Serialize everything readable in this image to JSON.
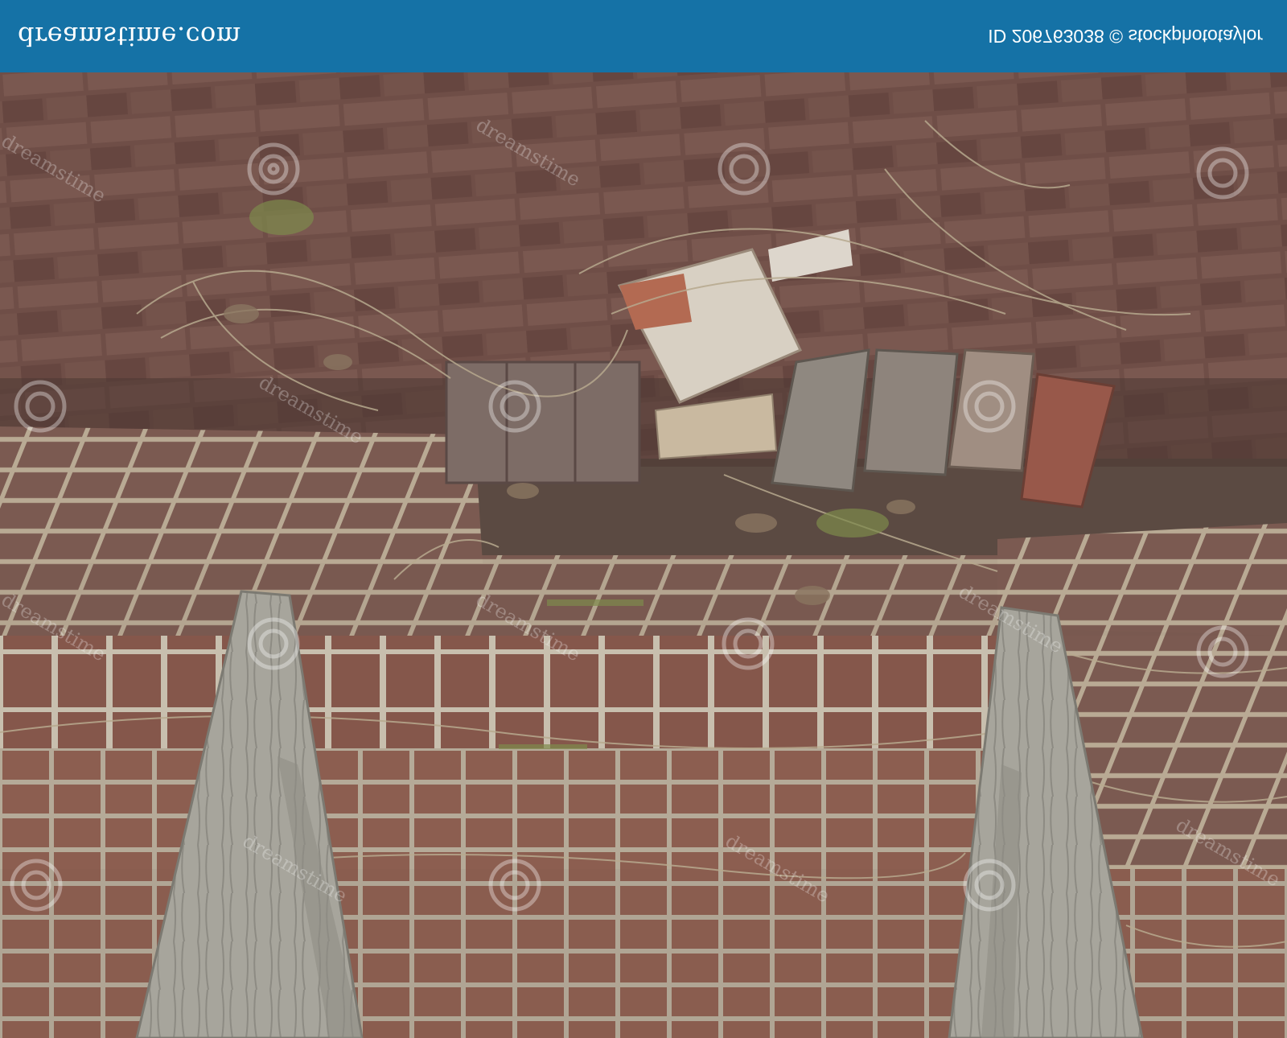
{
  "banner": {
    "logo_text": "dreamstime.com",
    "meta_text": "ID 206763038 © stockphototaylor",
    "background_color": "#1572a6",
    "text_color": "#ffffff"
  },
  "photo": {
    "subject": "upside-down view of a collapsed red brick wall top with loose bricks, dry grass, dead leaves and two weathered wooden posts",
    "dominant_colors": [
      "#6e4f47",
      "#8a6a5e",
      "#b3a58a",
      "#9a9a92"
    ]
  },
  "watermark": {
    "text": "dreamstime",
    "icon": "spiral-logo-icon"
  }
}
